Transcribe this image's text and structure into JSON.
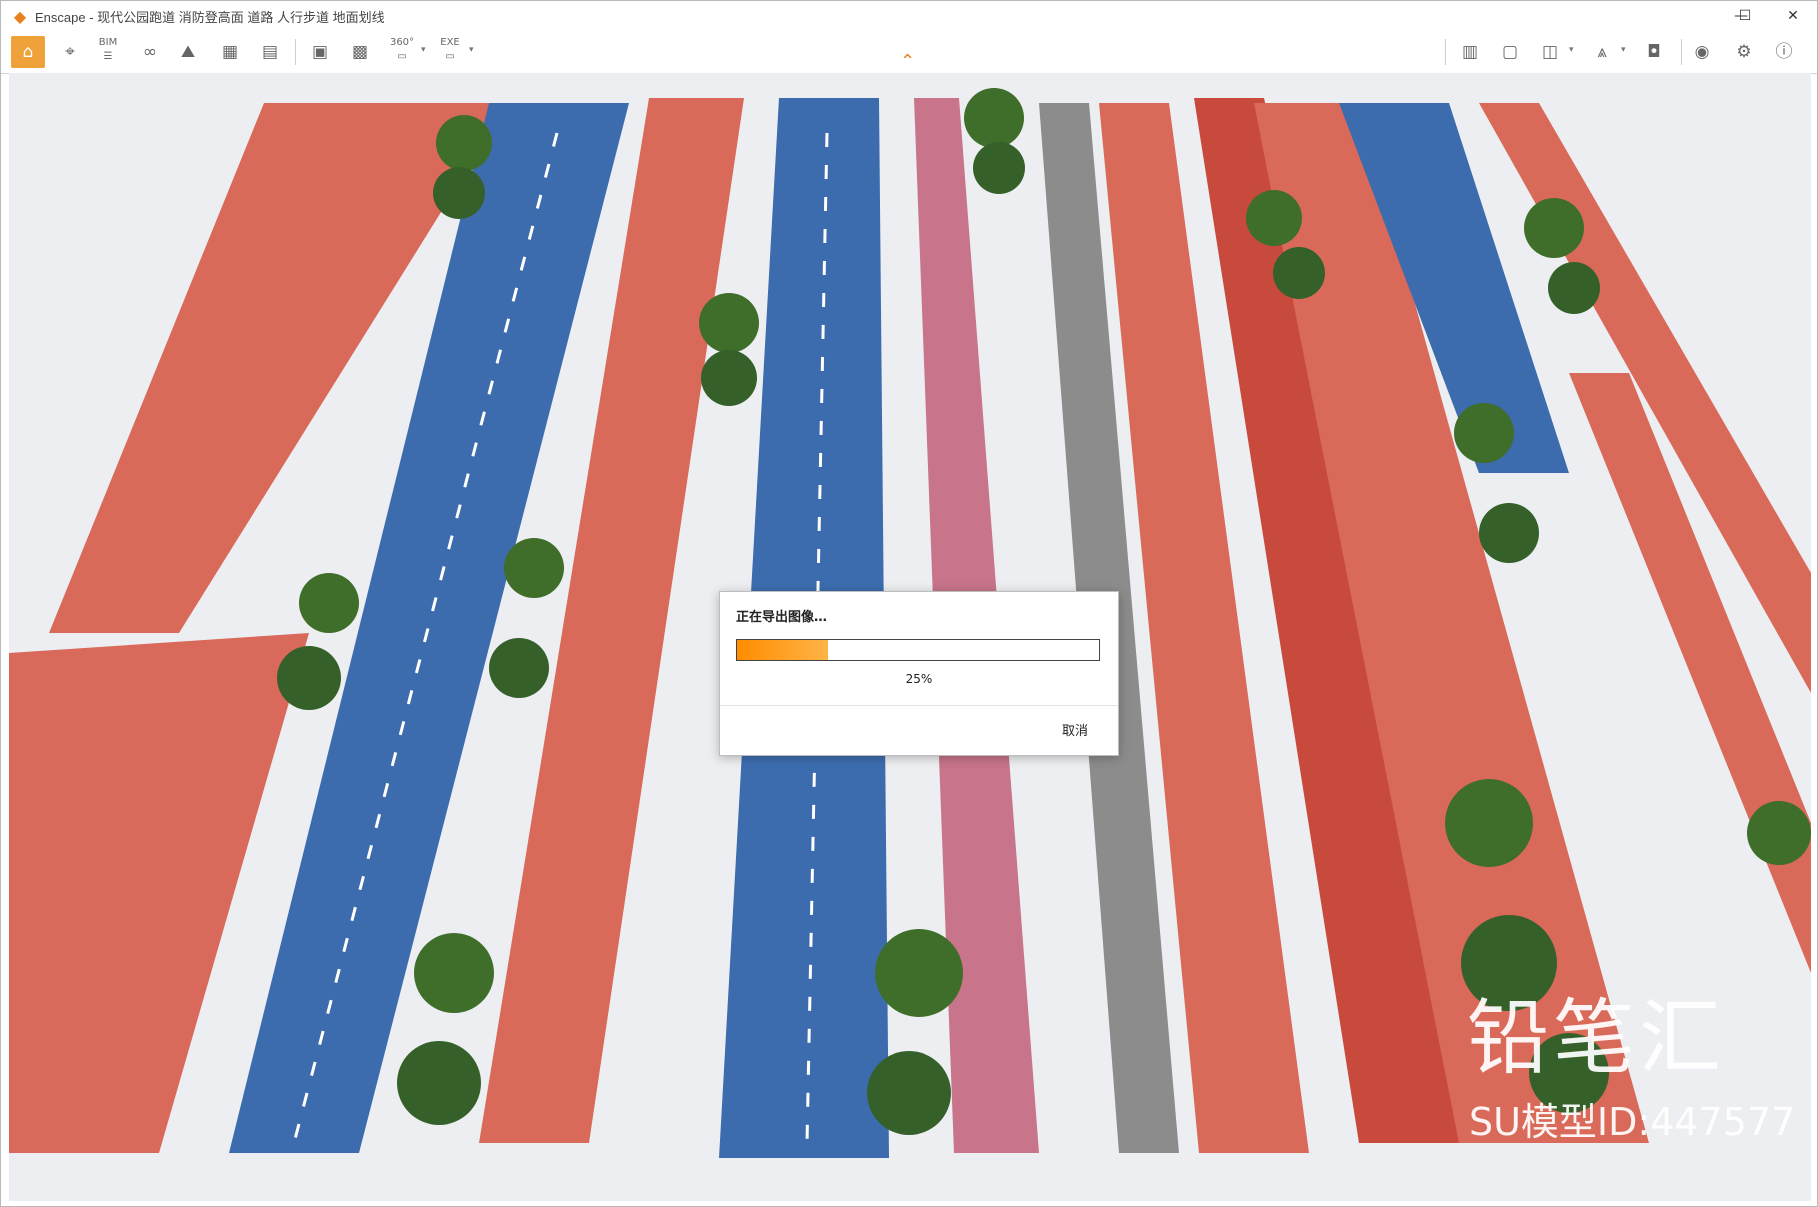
{
  "window": {
    "app_name": "Enscape",
    "title": "Enscape - 现代公园跑道 消防登高面 道路 人行步道 地面划线"
  },
  "window_controls": {
    "minimize": "—",
    "maximize": "☐",
    "close": "✕"
  },
  "toolbar": {
    "bim_label": "BIM",
    "exe_label": "EXE",
    "pano_label": "360°"
  },
  "dialog": {
    "title": "正在导出图像…",
    "progress_percent": 25,
    "progress_text": "25%",
    "cancel_label": "取消"
  },
  "watermark": {
    "brand": "铅笔汇",
    "model_id": "SU模型ID:447577"
  },
  "colors": {
    "accent": "#f0a23a",
    "track_red": "#d96a5a",
    "track_blue": "#3c6cae",
    "progress": "#ff8c00"
  }
}
